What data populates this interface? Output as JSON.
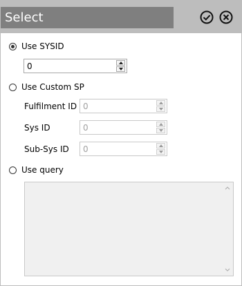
{
  "dialog": {
    "title": "Select",
    "confirm_icon": "check-circle-icon",
    "close_icon": "close-circle-icon"
  },
  "options": {
    "use_sysid": {
      "label": "Use SYSID",
      "selected": true,
      "value": "0"
    },
    "use_custom_sp": {
      "label": "Use Custom SP",
      "selected": false,
      "fields": [
        {
          "label": "Fulfilment ID",
          "value": "0"
        },
        {
          "label": "Sys ID",
          "value": "0"
        },
        {
          "label": "Sub-Sys ID",
          "value": "0"
        }
      ]
    },
    "use_query": {
      "label": "Use query",
      "selected": false,
      "query_text": ""
    }
  },
  "colors": {
    "header_bg": "#bdbdbd",
    "title_bg": "#7f7f7f",
    "title_text": "#ffffff",
    "disabled_text": "#a0a0a0"
  }
}
